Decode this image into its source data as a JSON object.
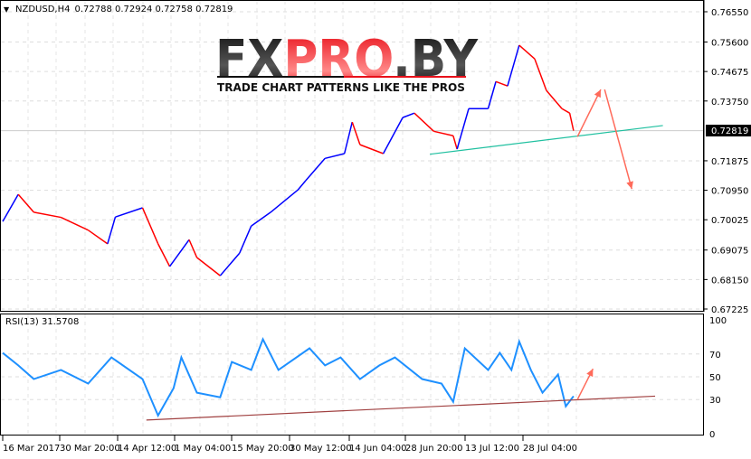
{
  "header": {
    "symbol": "NZDUSD,H4",
    "ohlc": "0.72788 0.72924 0.72758 0.72819"
  },
  "logo": {
    "brand": "FXPRO.BY",
    "tagline": "TRADE CHART PATTERNS LIKE THE PROS"
  },
  "rsi": {
    "label": "RSI(13) 31.5708"
  },
  "colors": {
    "up": "#0000ff",
    "down": "#ff0000",
    "rsi_line": "#1e90ff",
    "price_trendline": "#20c0a0",
    "rsi_trendline": "#a04040",
    "arrow": "#ff6a5a",
    "current_price_bg": "#000000"
  },
  "chart_data": [
    {
      "type": "line",
      "title": "NZDUSD,H4",
      "current_price": "0.72819",
      "y_ticks": [
        "0.76550",
        "0.75600",
        "0.74675",
        "0.73750",
        "0.71875",
        "0.70950",
        "0.70025",
        "0.69075",
        "0.68150",
        "0.67225"
      ],
      "ylim": [
        0.67225,
        0.7655
      ],
      "x_ticks": [
        "16 Mar 2017",
        "30 Mar 20:00",
        "14 Apr 12:00",
        "1 May 04:00",
        "15 May 20:00",
        "30 May 12:00",
        "14 Jun 04:00",
        "28 Jun 20:00",
        "13 Jul 12:00",
        "28 Jul 04:00"
      ],
      "grid": true,
      "series": [
        {
          "x": [
            "2017-03-16",
            "2017-03-20",
            "2017-03-24",
            "2017-03-31",
            "2017-04-07",
            "2017-04-12",
            "2017-04-14",
            "2017-04-21",
            "2017-04-25",
            "2017-04-28",
            "2017-05-03",
            "2017-05-05",
            "2017-05-11",
            "2017-05-16",
            "2017-05-19",
            "2017-05-24",
            "2017-05-31",
            "2017-06-02",
            "2017-06-07",
            "2017-06-12",
            "2017-06-14",
            "2017-06-16",
            "2017-06-22",
            "2017-06-27",
            "2017-06-30",
            "2017-07-05",
            "2017-07-10",
            "2017-07-11",
            "2017-07-14",
            "2017-07-19",
            "2017-07-21",
            "2017-07-24",
            "2017-07-27",
            "2017-07-31",
            "2017-08-03",
            "2017-08-07",
            "2017-08-09",
            "2017-08-10"
          ],
          "values": [
            0.6997,
            0.7082,
            0.7026,
            0.701,
            0.697,
            0.6927,
            0.7011,
            0.704,
            0.6927,
            0.6856,
            0.694,
            0.6884,
            0.6827,
            0.6898,
            0.6983,
            0.7026,
            0.7096,
            0.7125,
            0.7195,
            0.721,
            0.7309,
            0.7238,
            0.721,
            0.7323,
            0.7337,
            0.728,
            0.7266,
            0.7224,
            0.7351,
            0.7351,
            0.7436,
            0.7422,
            0.755,
            0.7507,
            0.7408,
            0.7351,
            0.7337,
            0.72819
          ]
        }
      ],
      "trendline": {
        "from": [
          "2017-07-04",
          0.7208
        ],
        "to": [
          "2017-09-02",
          0.7298
        ]
      },
      "arrows": [
        {
          "from": [
            "2017-08-11",
            0.7263
          ],
          "to": [
            "2017-08-17",
            0.7411
          ]
        },
        {
          "from": [
            "2017-08-18",
            0.7411
          ],
          "to": [
            "2017-08-25",
            0.7099
          ]
        }
      ]
    },
    {
      "type": "line",
      "title": "RSI(13) 31.5708",
      "y_ticks": [
        "100",
        "70",
        "50",
        "30",
        "0"
      ],
      "ylim": [
        0,
        100
      ],
      "series": [
        {
          "x": [
            "2017-03-16",
            "2017-03-20",
            "2017-03-24",
            "2017-03-31",
            "2017-04-07",
            "2017-04-13",
            "2017-04-21",
            "2017-04-25",
            "2017-04-29",
            "2017-05-01",
            "2017-05-05",
            "2017-05-11",
            "2017-05-14",
            "2017-05-19",
            "2017-05-22",
            "2017-05-26",
            "2017-06-03",
            "2017-06-07",
            "2017-06-11",
            "2017-06-16",
            "2017-06-21",
            "2017-06-25",
            "2017-07-02",
            "2017-07-07",
            "2017-07-10",
            "2017-07-13",
            "2017-07-19",
            "2017-07-22",
            "2017-07-25",
            "2017-07-27",
            "2017-07-30",
            "2017-08-02",
            "2017-08-06",
            "2017-08-08",
            "2017-08-10"
          ],
          "values": [
            71,
            60,
            48,
            56,
            44,
            67,
            48,
            16,
            40,
            67,
            36,
            32,
            63,
            56,
            83,
            56,
            75,
            60,
            67,
            48,
            60,
            67,
            48,
            44,
            28,
            75,
            56,
            71,
            56,
            81,
            56,
            36,
            52,
            24,
            33
          ]
        }
      ],
      "trendline": {
        "from": [
          "2017-04-22",
          12
        ],
        "to": [
          "2017-08-31",
          33
        ]
      },
      "arrows": [
        {
          "from": [
            "2017-08-11",
            30
          ],
          "to": [
            "2017-08-15",
            57
          ]
        }
      ]
    }
  ]
}
